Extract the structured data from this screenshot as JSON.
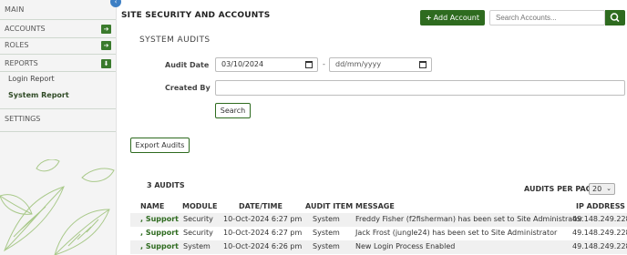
{
  "sidebar": {
    "main_label": "MAIN",
    "collapse_glyph": "‹",
    "sections": [
      {
        "label": "ACCOUNTS",
        "arrow": "➔"
      },
      {
        "label": "ROLES",
        "arrow": "➔"
      },
      {
        "label": "REPORTS",
        "arrow": "⬇"
      }
    ],
    "report_items": [
      {
        "label": "Login Report"
      },
      {
        "label": "System Report"
      }
    ],
    "settings_label": "SETTINGS"
  },
  "header": {
    "title": "SITE SECURITY AND ACCOUNTS",
    "add_account_label": "Add Account",
    "add_icon": "+",
    "search_placeholder": "Search Accounts..."
  },
  "audits": {
    "section_title": "SYSTEM AUDITS",
    "audit_date_label": "Audit Date",
    "date_from": "03/10/2024",
    "date_to": "dd/mm/yyyy",
    "date_separator": "-",
    "created_by_label": "Created By",
    "created_by_value": "",
    "search_label": "Search",
    "export_label": "Export Audits",
    "count_label": "3 AUDITS",
    "per_page_label": "AUDITS PER PAGE",
    "per_page_value": "20",
    "per_page_chevron": "⌄"
  },
  "table": {
    "columns": [
      "NAME",
      "MODULE",
      "DATE/TIME",
      "AUDIT ITEM",
      "MESSAGE",
      "IP ADDRESS"
    ],
    "rows": [
      {
        "name": ", Support",
        "module": "Security",
        "datetime": "10-Oct-2024 6:27 pm",
        "item": "System",
        "message": "Freddy Fisher (f2fisherman) has been set to Site Administrator",
        "ip": "49.148.249.228"
      },
      {
        "name": ", Support",
        "module": "Security",
        "datetime": "10-Oct-2024 6:27 pm",
        "item": "System",
        "message": "Jack Frost (jungle24) has been set to Site Administrator",
        "ip": "49.148.249.228"
      },
      {
        "name": ", Support",
        "module": "System",
        "datetime": "10-Oct-2024 6:26 pm",
        "item": "System",
        "message": "New Login Process Enabled",
        "ip": "49.148.249.228"
      }
    ]
  },
  "colors": {
    "brand_green": "#2e6b1f",
    "sidebar_bg": "#f4f4f4",
    "collapse_blue": "#3d7fc4"
  }
}
